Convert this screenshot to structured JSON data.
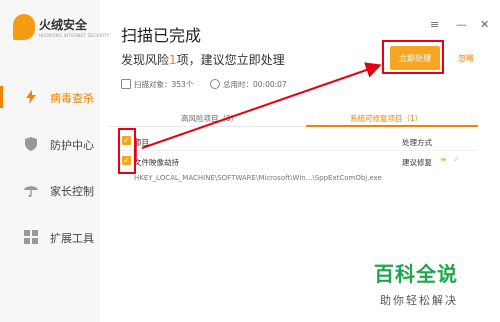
{
  "app": {
    "name": "火绒安全",
    "sub": "HUORONG INTERNET SECURITY"
  },
  "sidebar": {
    "items": [
      {
        "label": "病毒查杀",
        "icon": "lightning-icon",
        "active": true
      },
      {
        "label": "防护中心",
        "icon": "shield-icon",
        "active": false
      },
      {
        "label": "家长控制",
        "icon": "umbrella-icon",
        "active": false
      },
      {
        "label": "扩展工具",
        "icon": "grid-icon",
        "active": false
      }
    ]
  },
  "header": {
    "title": "扫描已完成",
    "menu_glyph": "≡",
    "minimize_glyph": "—",
    "close_glyph": "✕"
  },
  "summary": {
    "prefix": "发现风险",
    "count": "1",
    "suffix": "项，建议您立即处理",
    "scanned": "扫描对象：353个",
    "elapsed": "总用时：00:00:07"
  },
  "actions": {
    "handle_now": "立即处理",
    "ignore": "忽略"
  },
  "tabs": [
    {
      "label": "高风险项目（0）",
      "active": false
    },
    {
      "label": "系统可修复项目（1）",
      "active": true
    }
  ],
  "table": {
    "col_item": "项目",
    "col_action": "处理方式",
    "rows": [
      {
        "name": "文件映像劫持",
        "action": "建议修复",
        "path": "HKEY_LOCAL_MACHINE\\SOFTWARE\\Microsoft\\Win...\\SppExtComObj.exe"
      }
    ]
  },
  "watermark": {
    "title": "百科全说",
    "subtitle": "助你轻松解决"
  },
  "colors": {
    "accent": "#f08300",
    "button": "#f5a623",
    "annotation": "#e60012",
    "watermark": "#1fa64d"
  }
}
